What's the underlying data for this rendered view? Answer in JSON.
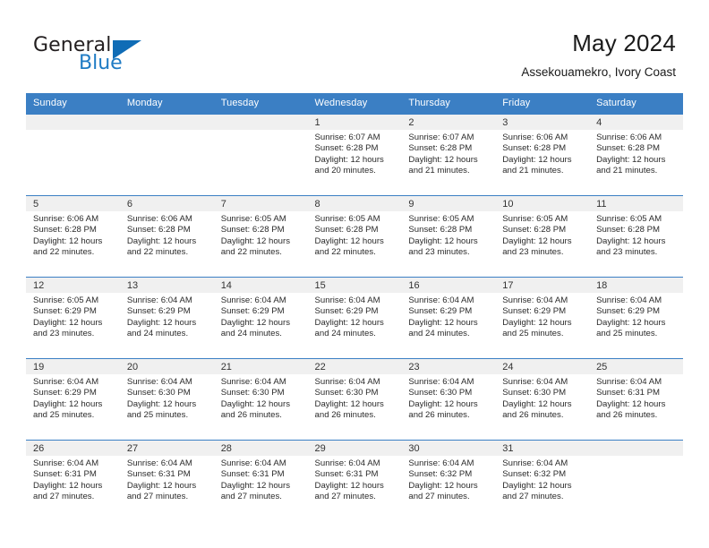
{
  "branding": {
    "logo_text_primary": "General",
    "logo_text_secondary": "Blue",
    "logo_icon": "triangle-flag-icon",
    "accent_color": "#0f6cb6",
    "header_color": "#3b7fc4"
  },
  "header": {
    "month_title": "May 2024",
    "location": "Assekouamekro, Ivory Coast"
  },
  "calendar": {
    "weekday_headers": [
      "Sunday",
      "Monday",
      "Tuesday",
      "Wednesday",
      "Thursday",
      "Friday",
      "Saturday"
    ],
    "weeks": [
      [
        {
          "day": "",
          "empty": true
        },
        {
          "day": "",
          "empty": true
        },
        {
          "day": "",
          "empty": true
        },
        {
          "day": "1",
          "sunrise": "Sunrise: 6:07 AM",
          "sunset": "Sunset: 6:28 PM",
          "daylight_line1": "Daylight: 12 hours",
          "daylight_line2": "and 20 minutes."
        },
        {
          "day": "2",
          "sunrise": "Sunrise: 6:07 AM",
          "sunset": "Sunset: 6:28 PM",
          "daylight_line1": "Daylight: 12 hours",
          "daylight_line2": "and 21 minutes."
        },
        {
          "day": "3",
          "sunrise": "Sunrise: 6:06 AM",
          "sunset": "Sunset: 6:28 PM",
          "daylight_line1": "Daylight: 12 hours",
          "daylight_line2": "and 21 minutes."
        },
        {
          "day": "4",
          "sunrise": "Sunrise: 6:06 AM",
          "sunset": "Sunset: 6:28 PM",
          "daylight_line1": "Daylight: 12 hours",
          "daylight_line2": "and 21 minutes."
        }
      ],
      [
        {
          "day": "5",
          "sunrise": "Sunrise: 6:06 AM",
          "sunset": "Sunset: 6:28 PM",
          "daylight_line1": "Daylight: 12 hours",
          "daylight_line2": "and 22 minutes."
        },
        {
          "day": "6",
          "sunrise": "Sunrise: 6:06 AM",
          "sunset": "Sunset: 6:28 PM",
          "daylight_line1": "Daylight: 12 hours",
          "daylight_line2": "and 22 minutes."
        },
        {
          "day": "7",
          "sunrise": "Sunrise: 6:05 AM",
          "sunset": "Sunset: 6:28 PM",
          "daylight_line1": "Daylight: 12 hours",
          "daylight_line2": "and 22 minutes."
        },
        {
          "day": "8",
          "sunrise": "Sunrise: 6:05 AM",
          "sunset": "Sunset: 6:28 PM",
          "daylight_line1": "Daylight: 12 hours",
          "daylight_line2": "and 22 minutes."
        },
        {
          "day": "9",
          "sunrise": "Sunrise: 6:05 AM",
          "sunset": "Sunset: 6:28 PM",
          "daylight_line1": "Daylight: 12 hours",
          "daylight_line2": "and 23 minutes."
        },
        {
          "day": "10",
          "sunrise": "Sunrise: 6:05 AM",
          "sunset": "Sunset: 6:28 PM",
          "daylight_line1": "Daylight: 12 hours",
          "daylight_line2": "and 23 minutes."
        },
        {
          "day": "11",
          "sunrise": "Sunrise: 6:05 AM",
          "sunset": "Sunset: 6:28 PM",
          "daylight_line1": "Daylight: 12 hours",
          "daylight_line2": "and 23 minutes."
        }
      ],
      [
        {
          "day": "12",
          "sunrise": "Sunrise: 6:05 AM",
          "sunset": "Sunset: 6:29 PM",
          "daylight_line1": "Daylight: 12 hours",
          "daylight_line2": "and 23 minutes."
        },
        {
          "day": "13",
          "sunrise": "Sunrise: 6:04 AM",
          "sunset": "Sunset: 6:29 PM",
          "daylight_line1": "Daylight: 12 hours",
          "daylight_line2": "and 24 minutes."
        },
        {
          "day": "14",
          "sunrise": "Sunrise: 6:04 AM",
          "sunset": "Sunset: 6:29 PM",
          "daylight_line1": "Daylight: 12 hours",
          "daylight_line2": "and 24 minutes."
        },
        {
          "day": "15",
          "sunrise": "Sunrise: 6:04 AM",
          "sunset": "Sunset: 6:29 PM",
          "daylight_line1": "Daylight: 12 hours",
          "daylight_line2": "and 24 minutes."
        },
        {
          "day": "16",
          "sunrise": "Sunrise: 6:04 AM",
          "sunset": "Sunset: 6:29 PM",
          "daylight_line1": "Daylight: 12 hours",
          "daylight_line2": "and 24 minutes."
        },
        {
          "day": "17",
          "sunrise": "Sunrise: 6:04 AM",
          "sunset": "Sunset: 6:29 PM",
          "daylight_line1": "Daylight: 12 hours",
          "daylight_line2": "and 25 minutes."
        },
        {
          "day": "18",
          "sunrise": "Sunrise: 6:04 AM",
          "sunset": "Sunset: 6:29 PM",
          "daylight_line1": "Daylight: 12 hours",
          "daylight_line2": "and 25 minutes."
        }
      ],
      [
        {
          "day": "19",
          "sunrise": "Sunrise: 6:04 AM",
          "sunset": "Sunset: 6:29 PM",
          "daylight_line1": "Daylight: 12 hours",
          "daylight_line2": "and 25 minutes."
        },
        {
          "day": "20",
          "sunrise": "Sunrise: 6:04 AM",
          "sunset": "Sunset: 6:30 PM",
          "daylight_line1": "Daylight: 12 hours",
          "daylight_line2": "and 25 minutes."
        },
        {
          "day": "21",
          "sunrise": "Sunrise: 6:04 AM",
          "sunset": "Sunset: 6:30 PM",
          "daylight_line1": "Daylight: 12 hours",
          "daylight_line2": "and 26 minutes."
        },
        {
          "day": "22",
          "sunrise": "Sunrise: 6:04 AM",
          "sunset": "Sunset: 6:30 PM",
          "daylight_line1": "Daylight: 12 hours",
          "daylight_line2": "and 26 minutes."
        },
        {
          "day": "23",
          "sunrise": "Sunrise: 6:04 AM",
          "sunset": "Sunset: 6:30 PM",
          "daylight_line1": "Daylight: 12 hours",
          "daylight_line2": "and 26 minutes."
        },
        {
          "day": "24",
          "sunrise": "Sunrise: 6:04 AM",
          "sunset": "Sunset: 6:30 PM",
          "daylight_line1": "Daylight: 12 hours",
          "daylight_line2": "and 26 minutes."
        },
        {
          "day": "25",
          "sunrise": "Sunrise: 6:04 AM",
          "sunset": "Sunset: 6:31 PM",
          "daylight_line1": "Daylight: 12 hours",
          "daylight_line2": "and 26 minutes."
        }
      ],
      [
        {
          "day": "26",
          "sunrise": "Sunrise: 6:04 AM",
          "sunset": "Sunset: 6:31 PM",
          "daylight_line1": "Daylight: 12 hours",
          "daylight_line2": "and 27 minutes."
        },
        {
          "day": "27",
          "sunrise": "Sunrise: 6:04 AM",
          "sunset": "Sunset: 6:31 PM",
          "daylight_line1": "Daylight: 12 hours",
          "daylight_line2": "and 27 minutes."
        },
        {
          "day": "28",
          "sunrise": "Sunrise: 6:04 AM",
          "sunset": "Sunset: 6:31 PM",
          "daylight_line1": "Daylight: 12 hours",
          "daylight_line2": "and 27 minutes."
        },
        {
          "day": "29",
          "sunrise": "Sunrise: 6:04 AM",
          "sunset": "Sunset: 6:31 PM",
          "daylight_line1": "Daylight: 12 hours",
          "daylight_line2": "and 27 minutes."
        },
        {
          "day": "30",
          "sunrise": "Sunrise: 6:04 AM",
          "sunset": "Sunset: 6:32 PM",
          "daylight_line1": "Daylight: 12 hours",
          "daylight_line2": "and 27 minutes."
        },
        {
          "day": "31",
          "sunrise": "Sunrise: 6:04 AM",
          "sunset": "Sunset: 6:32 PM",
          "daylight_line1": "Daylight: 12 hours",
          "daylight_line2": "and 27 minutes."
        },
        {
          "day": "",
          "empty": true
        }
      ]
    ]
  }
}
